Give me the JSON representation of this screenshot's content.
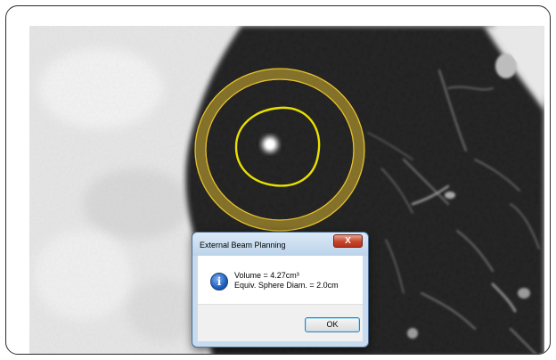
{
  "image": {
    "description_icon": "ct-lung-scan"
  },
  "colors": {
    "outer_contour": "#d4b030",
    "inner_contour": "#e8e000"
  },
  "dialog": {
    "title": "External Beam Planning",
    "close_icon": "close-icon",
    "info_icon": "info-icon",
    "message_line1": "Volume = 4.27cm³",
    "message_line2": "Equiv. Sphere Diam. = 2.0cm",
    "ok_label": "OK"
  }
}
